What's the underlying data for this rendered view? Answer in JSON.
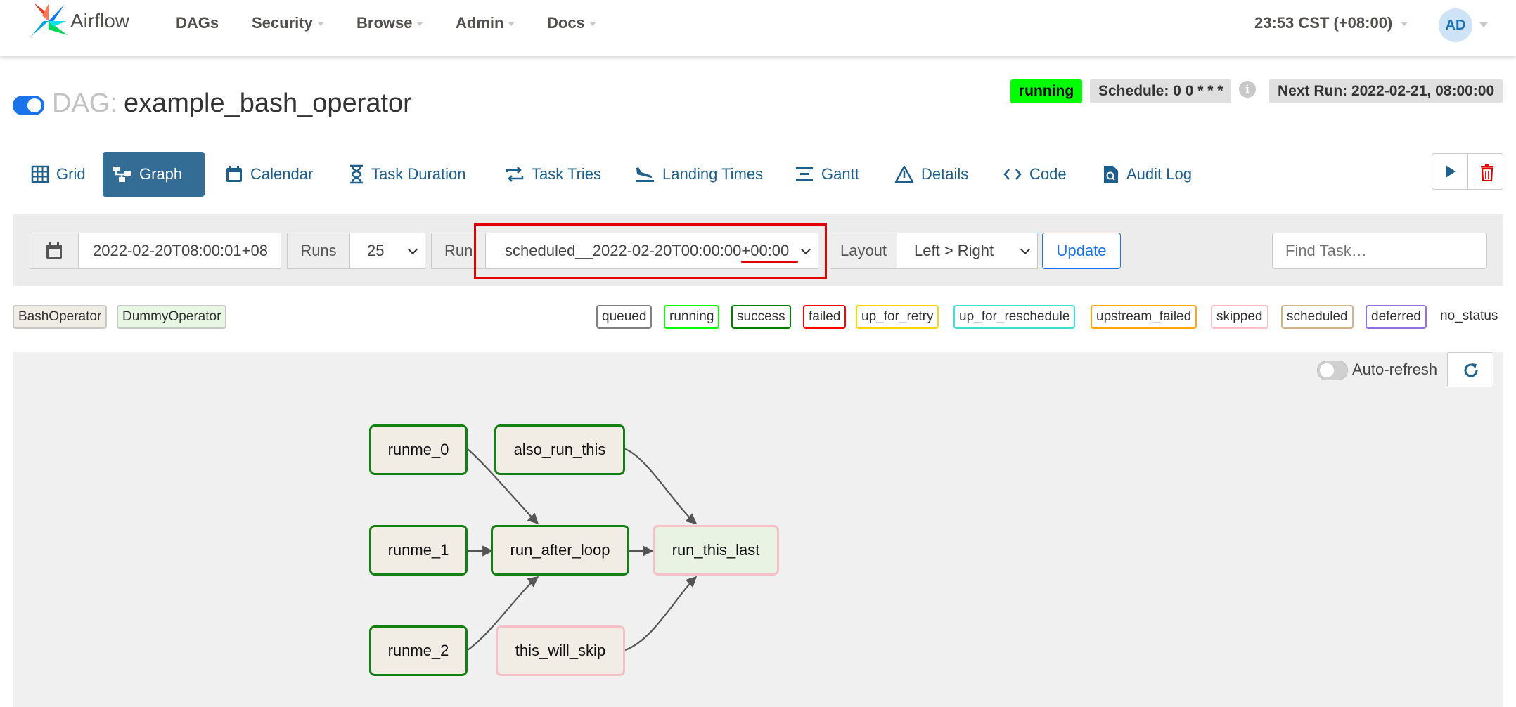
{
  "nav": {
    "brand": "Airflow",
    "items": [
      {
        "label": "DAGs"
      },
      {
        "label": "Security"
      },
      {
        "label": "Browse"
      },
      {
        "label": "Admin"
      },
      {
        "label": "Docs"
      }
    ],
    "clock": "23:53 CST (+08:00)",
    "user_initials": "AD"
  },
  "dag": {
    "prefix": "DAG:",
    "name": "example_bash_operator",
    "paused": false,
    "state_badge": "running",
    "schedule": "Schedule: 0 0 * * *",
    "next_run": "Next Run: 2022-02-21, 08:00:00"
  },
  "tabs": [
    {
      "label": "Grid",
      "icon": "grid-icon"
    },
    {
      "label": "Graph",
      "icon": "graph-icon",
      "active": true
    },
    {
      "label": "Calendar",
      "icon": "calendar-icon"
    },
    {
      "label": "Task Duration",
      "icon": "hourglass-icon"
    },
    {
      "label": "Task Tries",
      "icon": "repeat-icon"
    },
    {
      "label": "Landing Times",
      "icon": "plane-landing-icon"
    },
    {
      "label": "Gantt",
      "icon": "gantt-icon"
    },
    {
      "label": "Details",
      "icon": "warning-triangle-icon"
    },
    {
      "label": "Code",
      "icon": "code-icon"
    },
    {
      "label": "Audit Log",
      "icon": "file-search-icon"
    }
  ],
  "filters": {
    "base_date": "2022-02-20T08:00:01+08",
    "runs_label": "Runs",
    "runs_value": "25",
    "run_label": "Run",
    "run_value": "scheduled__2022-02-20T00:00:00+00:00",
    "layout_label": "Layout",
    "layout_value": "Left > Right",
    "update_label": "Update",
    "find_placeholder": "Find Task…"
  },
  "operators": [
    {
      "label": "BashOperator",
      "color": "#f0ede4"
    },
    {
      "label": "DummyOperator",
      "color": "#e8f7e4"
    }
  ],
  "states": [
    {
      "label": "queued",
      "color": "#808080"
    },
    {
      "label": "running",
      "color": "#00ff00"
    },
    {
      "label": "success",
      "color": "#008000"
    },
    {
      "label": "failed",
      "color": "#ff0000"
    },
    {
      "label": "up_for_retry",
      "color": "#ffd700"
    },
    {
      "label": "up_for_reschedule",
      "color": "#40e0d0"
    },
    {
      "label": "upstream_failed",
      "color": "#ffa500"
    },
    {
      "label": "skipped",
      "color": "#ffc0cb"
    },
    {
      "label": "scheduled",
      "color": "#d2b48c"
    },
    {
      "label": "deferred",
      "color": "#9370db"
    }
  ],
  "no_status_label": "no_status",
  "graph": {
    "auto_refresh_label": "Auto-refresh",
    "nodes": [
      {
        "id": "runme_0",
        "label": "runme_0",
        "operator": "BashOperator",
        "state": "success"
      },
      {
        "id": "runme_1",
        "label": "runme_1",
        "operator": "BashOperator",
        "state": "success"
      },
      {
        "id": "runme_2",
        "label": "runme_2",
        "operator": "BashOperator",
        "state": "success"
      },
      {
        "id": "also_run_this",
        "label": "also_run_this",
        "operator": "BashOperator",
        "state": "success"
      },
      {
        "id": "run_after_loop",
        "label": "run_after_loop",
        "operator": "BashOperator",
        "state": "success"
      },
      {
        "id": "this_will_skip",
        "label": "this_will_skip",
        "operator": "BashOperator",
        "state": "skipped"
      },
      {
        "id": "run_this_last",
        "label": "run_this_last",
        "operator": "DummyOperator",
        "state": "skipped"
      }
    ],
    "edges": [
      [
        "runme_0",
        "run_after_loop"
      ],
      [
        "runme_1",
        "run_after_loop"
      ],
      [
        "runme_2",
        "run_after_loop"
      ],
      [
        "run_after_loop",
        "run_this_last"
      ],
      [
        "also_run_this",
        "run_this_last"
      ],
      [
        "this_will_skip",
        "run_this_last"
      ]
    ]
  }
}
